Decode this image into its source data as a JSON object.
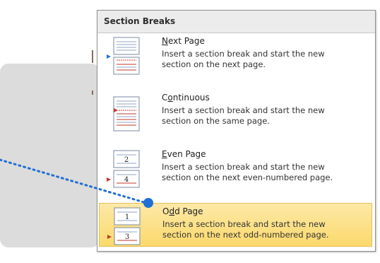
{
  "menu": {
    "header": "Section Breaks",
    "items": [
      {
        "title_accel": "N",
        "title_rest": "ext Page",
        "desc_line1": "Insert a section break and start the new",
        "desc_line2": "section on the next page.",
        "icon": "next-page-icon"
      },
      {
        "title_pre": "C",
        "title_accel": "o",
        "title_rest": "ntinuous",
        "desc_line1": "Insert a section break and start the new",
        "desc_line2": "section on the same page.",
        "icon": "continuous-icon"
      },
      {
        "title_accel": "E",
        "title_rest": "ven Page",
        "desc_line1": "Insert a section break and start the new",
        "desc_line2": "section on the next even-numbered page.",
        "icon": "even-page-icon",
        "icon_numbers": [
          "2",
          "4"
        ]
      },
      {
        "title_pre": "O",
        "title_accel": "d",
        "title_rest": "d Page",
        "desc_line1": "Insert a section break and start the new",
        "desc_line2": "section on the next odd-numbered page.",
        "icon": "odd-page-icon",
        "icon_numbers": [
          "1",
          "3"
        ],
        "highlighted": true
      }
    ]
  },
  "colors": {
    "highlight_top": "#fde9a8",
    "highlight_bottom": "#fbd96c",
    "callout_blue": "#1f6fd6",
    "section_red": "#c0392b"
  }
}
